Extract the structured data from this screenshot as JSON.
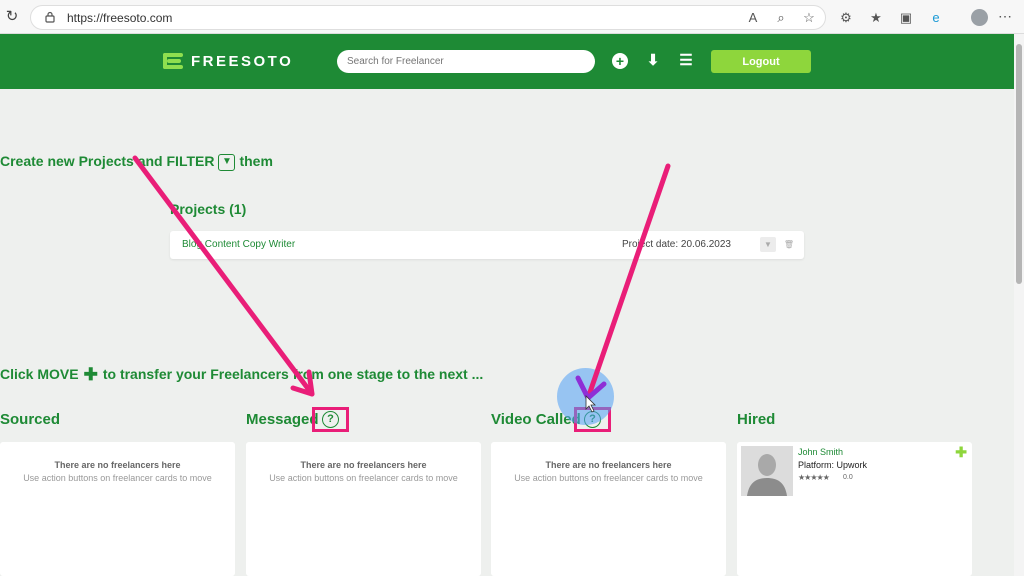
{
  "browser": {
    "url": "https://freesoto.com",
    "icons": [
      "reload-icon",
      "lock-icon",
      "read-aloud-icon",
      "zoom-icon",
      "favorite-star-icon",
      "extensions-icon",
      "favorites-icon",
      "collections-icon",
      "edge-icon",
      "profile-icon",
      "menu-icon"
    ]
  },
  "header": {
    "logo_text": "FREESOTO",
    "search_placeholder": "Search for Freelancer",
    "logout_label": "Logout",
    "colors": {
      "bar": "#1e8a35",
      "logout": "#8ed63c"
    }
  },
  "projects_section": {
    "instruction_before": "Create new Projects and FILTER",
    "instruction_after": "them",
    "title": "Projects (1)",
    "items": [
      {
        "name": "Blog Content Copy Writer",
        "date_label": "Project date: 20.06.2023"
      }
    ]
  },
  "stages_section": {
    "instruction_before": "Click MOVE",
    "instruction_after": "to transfer your Freelancers from one stage to the next ...",
    "stages": [
      {
        "title": "Sourced",
        "empty_title": "There are no freelancers here",
        "empty_hint": "Use action buttons on freelancer cards to move"
      },
      {
        "title": "Messaged",
        "empty_title": "There are no freelancers here",
        "empty_hint": "Use action buttons on freelancer cards to move"
      },
      {
        "title": "Video Called",
        "empty_title": "There are no freelancers here",
        "empty_hint": "Use action buttons on freelancer cards to move"
      },
      {
        "title": "Hired",
        "freelancer": {
          "name": "John Smith",
          "platform": "Platform: Upwork",
          "stars": "★★★★★",
          "rating": "0.0"
        }
      }
    ],
    "help_glyph": "?"
  },
  "annotation_color": "#e91e78"
}
